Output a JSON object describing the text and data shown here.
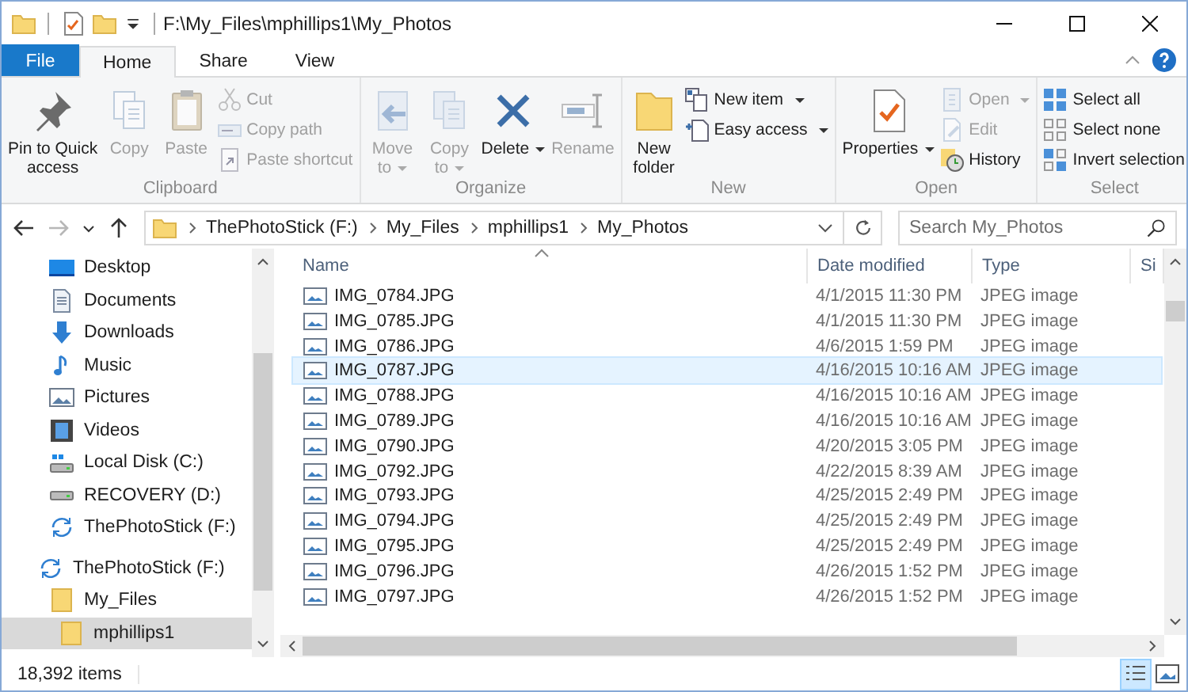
{
  "window": {
    "title": "F:\\My_Files\\mphillips1\\My_Photos"
  },
  "tabs": [
    {
      "label": "File",
      "kind": "file",
      "selected": false
    },
    {
      "label": "Home",
      "kind": "tab",
      "selected": true
    },
    {
      "label": "Share",
      "kind": "tab",
      "selected": false
    },
    {
      "label": "View",
      "kind": "tab",
      "selected": false
    }
  ],
  "ribbon": {
    "groups": [
      {
        "label": "Clipboard",
        "items": [
          {
            "kind": "large",
            "label": "Pin to Quick\naccess",
            "disabled": false,
            "dropdown": false
          },
          {
            "kind": "large",
            "label": "Copy",
            "disabled": true,
            "dropdown": false
          },
          {
            "kind": "large",
            "label": "Paste",
            "disabled": true,
            "dropdown": false
          },
          {
            "kind": "stack",
            "items": [
              {
                "label": "Cut",
                "disabled": true,
                "dropdown": false
              },
              {
                "label": "Copy path",
                "disabled": true,
                "dropdown": false
              },
              {
                "label": "Paste shortcut",
                "disabled": true,
                "dropdown": false
              }
            ]
          }
        ]
      },
      {
        "label": "Organize",
        "items": [
          {
            "kind": "large",
            "label": "Move\nto",
            "disabled": true,
            "dropdown": true
          },
          {
            "kind": "large",
            "label": "Copy\nto",
            "disabled": true,
            "dropdown": true
          },
          {
            "kind": "large",
            "label": "Delete",
            "disabled": false,
            "dropdown": true
          },
          {
            "kind": "large",
            "label": "Rename",
            "disabled": true,
            "dropdown": false
          }
        ]
      },
      {
        "label": "New",
        "items": [
          {
            "kind": "large",
            "label": "New\nfolder",
            "disabled": false,
            "dropdown": false
          },
          {
            "kind": "stack",
            "items": [
              {
                "label": "New item",
                "disabled": false,
                "dropdown": true
              },
              {
                "label": "Easy access",
                "disabled": false,
                "dropdown": true
              }
            ]
          }
        ]
      },
      {
        "label": "Open",
        "items": [
          {
            "kind": "large",
            "label": "Properties",
            "disabled": false,
            "dropdown": true
          },
          {
            "kind": "stack",
            "items": [
              {
                "label": "Open",
                "disabled": true,
                "dropdown": true
              },
              {
                "label": "Edit",
                "disabled": true,
                "dropdown": false
              },
              {
                "label": "History",
                "disabled": false,
                "dropdown": false
              }
            ]
          }
        ]
      },
      {
        "label": "Select",
        "items": [
          {
            "kind": "stack",
            "items": [
              {
                "label": "Select all",
                "disabled": false,
                "dropdown": false
              },
              {
                "label": "Select none",
                "disabled": false,
                "dropdown": false
              },
              {
                "label": "Invert selection",
                "disabled": false,
                "dropdown": false
              }
            ]
          }
        ]
      }
    ]
  },
  "navigation": [
    {
      "disabled": false
    },
    {
      "disabled": true
    },
    {
      "disabled": false
    },
    {
      "disabled": false
    }
  ],
  "address": {
    "segments": [
      "ThePhotoStick (F:)",
      "My_Files",
      "mphillips1",
      "My_Photos"
    ]
  },
  "search": {
    "placeholder": "Search My_Photos"
  },
  "sidebar": {
    "quick_access": [
      {
        "label": "Desktop",
        "selected": false
      },
      {
        "label": "Documents",
        "selected": false
      },
      {
        "label": "Downloads",
        "selected": false
      },
      {
        "label": "Music",
        "selected": false
      },
      {
        "label": "Pictures",
        "selected": false
      },
      {
        "label": "Videos",
        "selected": false
      },
      {
        "label": "Local Disk (C:)",
        "selected": false
      },
      {
        "label": "RECOVERY (D:)",
        "selected": false
      },
      {
        "label": "ThePhotoStick (F:)",
        "selected": false
      }
    ],
    "tree": [
      {
        "label": "ThePhotoStick (F:)",
        "selected": false,
        "children": [
          {
            "label": "My_Files",
            "selected": false,
            "children": [
              {
                "label": "mphillips1",
                "selected": true
              }
            ]
          }
        ]
      }
    ]
  },
  "table": {
    "columns": [
      {
        "label": "Name",
        "sorted": true
      },
      {
        "label": "Date modified",
        "sorted": false
      },
      {
        "label": "Type",
        "sorted": false
      },
      {
        "label": "Si",
        "sorted": false
      }
    ],
    "rows": [
      {
        "name": "IMG_0784.JPG",
        "date_modified": "4/1/2015 11:30 PM",
        "type": "JPEG image",
        "selected": false
      },
      {
        "name": "IMG_0785.JPG",
        "date_modified": "4/1/2015 11:30 PM",
        "type": "JPEG image",
        "selected": false
      },
      {
        "name": "IMG_0786.JPG",
        "date_modified": "4/6/2015 1:59 PM",
        "type": "JPEG image",
        "selected": false
      },
      {
        "name": "IMG_0787.JPG",
        "date_modified": "4/16/2015 10:16 AM",
        "type": "JPEG image",
        "selected": true
      },
      {
        "name": "IMG_0788.JPG",
        "date_modified": "4/16/2015 10:16 AM",
        "type": "JPEG image",
        "selected": false
      },
      {
        "name": "IMG_0789.JPG",
        "date_modified": "4/16/2015 10:16 AM",
        "type": "JPEG image",
        "selected": false
      },
      {
        "name": "IMG_0790.JPG",
        "date_modified": "4/20/2015 3:05 PM",
        "type": "JPEG image",
        "selected": false
      },
      {
        "name": "IMG_0792.JPG",
        "date_modified": "4/22/2015 8:39 AM",
        "type": "JPEG image",
        "selected": false
      },
      {
        "name": "IMG_0793.JPG",
        "date_modified": "4/25/2015 2:49 PM",
        "type": "JPEG image",
        "selected": false
      },
      {
        "name": "IMG_0794.JPG",
        "date_modified": "4/25/2015 2:49 PM",
        "type": "JPEG image",
        "selected": false
      },
      {
        "name": "IMG_0795.JPG",
        "date_modified": "4/25/2015 2:49 PM",
        "type": "JPEG image",
        "selected": false
      },
      {
        "name": "IMG_0796.JPG",
        "date_modified": "4/26/2015 1:52 PM",
        "type": "JPEG image",
        "selected": false
      },
      {
        "name": "IMG_0797.JPG",
        "date_modified": "4/26/2015 1:52 PM",
        "type": "JPEG image",
        "selected": false
      }
    ]
  },
  "status_bar": {
    "item_count": "18,392 items",
    "views": [
      {
        "selected": true
      },
      {
        "selected": false
      }
    ]
  }
}
